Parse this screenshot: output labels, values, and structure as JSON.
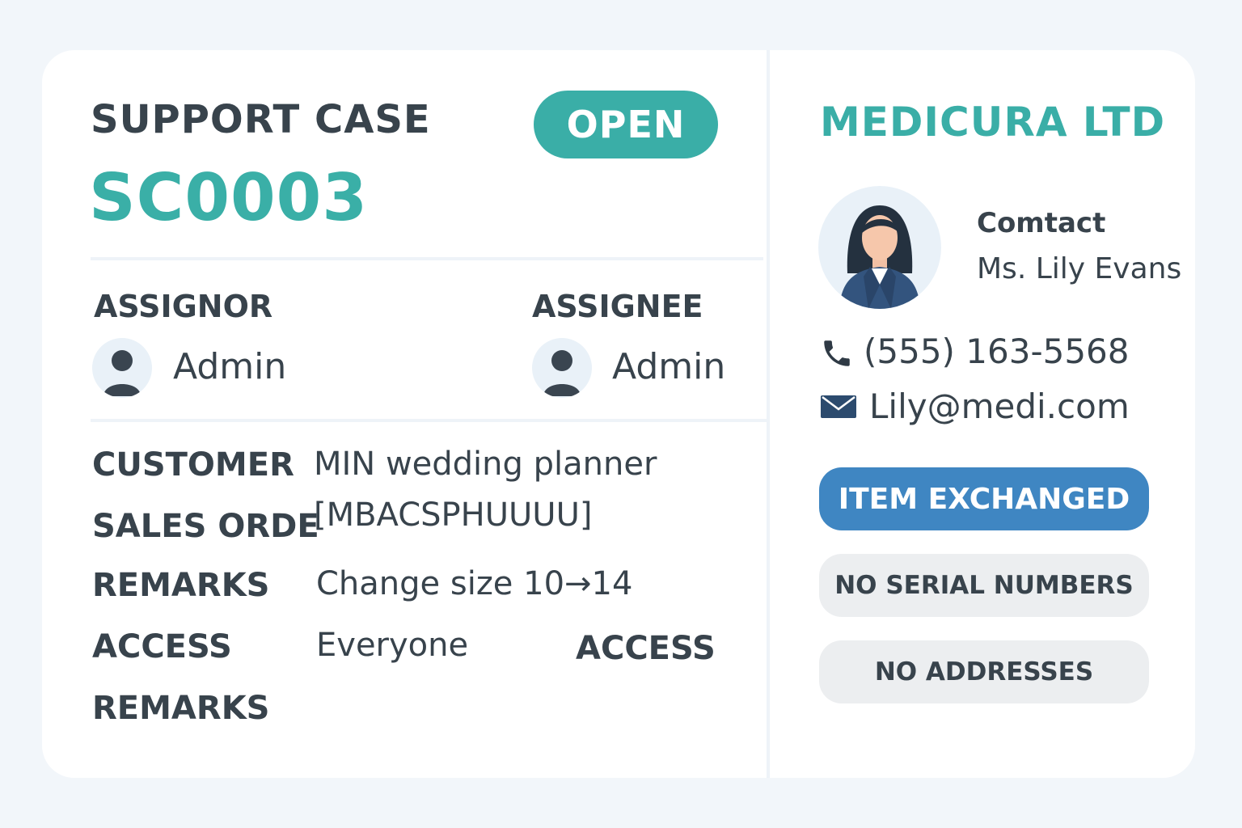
{
  "case": {
    "label": "SUPPORT CASE",
    "id": "SC0003",
    "status": "OPEN"
  },
  "assignor": {
    "heading": "ASSIGNOR",
    "name": "Admin",
    "avatar_icon": "user-icon"
  },
  "assignee": {
    "heading": "ASSIGNEE",
    "name": "Admin",
    "avatar_icon": "user-icon"
  },
  "fields": {
    "customer_label": "CUSTOMER",
    "customer_value": "MIN wedding planner",
    "sales_order_label": "SALES ORDE",
    "sales_order_value": "[MBACSPHUUUU]",
    "remarks_label": "REMARKS",
    "remarks_value": "Change size 10→14",
    "access_label": "ACCESS",
    "access_value": "Everyone",
    "access_label_right": "ACCESS",
    "remarks_label_2": "REMARKS"
  },
  "company": {
    "name": "MEDICURA LTD",
    "contact_label": "Comtact",
    "contact_name": "Ms. Lily Evans",
    "phone": "(555) 163-5568",
    "email": "Lily@medi.com",
    "phone_icon": "phone-icon",
    "email_icon": "envelope-icon"
  },
  "tags": {
    "primary": "ITEM EXCHANGED",
    "secondary_1": "NO SERIAL NUMBERS",
    "secondary_2": "NO ADDRESSES"
  },
  "colors": {
    "accent_teal": "#3aaea7",
    "accent_blue": "#3f86c2",
    "text_dark": "#38434c",
    "muted_tag": "#eceef0",
    "background": "#f2f6fa"
  }
}
